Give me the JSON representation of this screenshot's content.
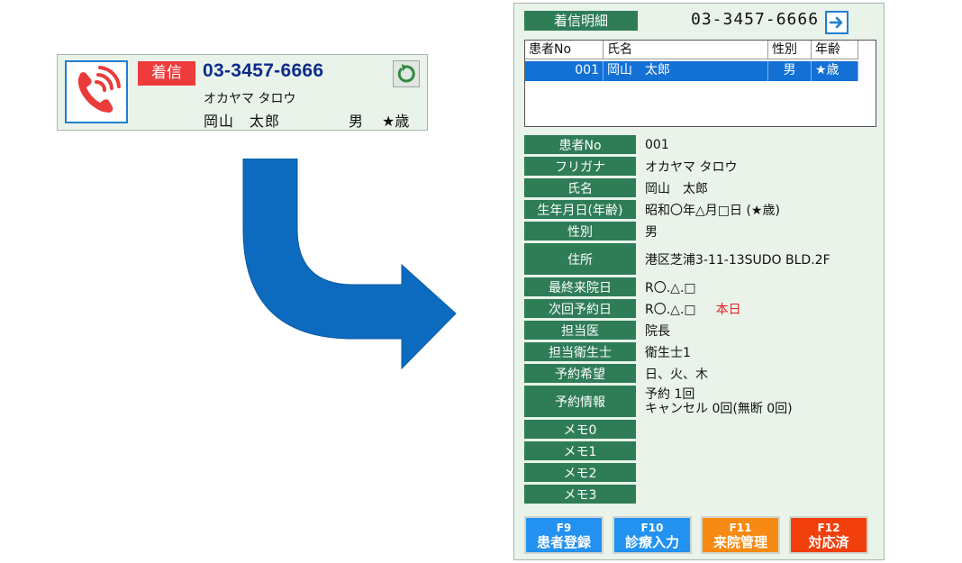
{
  "notification": {
    "badge": "着信",
    "phone": "03-3457-6666",
    "kana": "オカヤマ タロウ",
    "name": "岡山　太郎",
    "sex": "男",
    "age": "★歳",
    "icons": {
      "phone": "phone-ringing-icon",
      "refresh": "refresh-icon"
    }
  },
  "panel": {
    "title": "着信明細",
    "phone": "03-3457-6666",
    "table": {
      "headers": [
        "患者No",
        "氏名",
        "性別",
        "年齢"
      ],
      "rows": [
        {
          "no": "001",
          "name": "岡山　太郎",
          "sex": "男",
          "age": "★歳"
        }
      ]
    },
    "details": [
      {
        "label": "患者No",
        "value": "001"
      },
      {
        "label": "フリガナ",
        "value": "オカヤマ タロウ"
      },
      {
        "label": "氏名",
        "value": "岡山　太郎"
      },
      {
        "label": "生年月日(年齢)",
        "value": "昭和〇年△月□日 (★歳)"
      },
      {
        "label": "性別",
        "value": "男"
      },
      {
        "label": "住所",
        "value": "港区芝浦3-11-13SUDO BLD.2F"
      },
      {
        "label": "最終来院日",
        "value": "R〇.△.□"
      },
      {
        "label": "次回予約日",
        "value": "R〇.△.□",
        "note": "本日"
      },
      {
        "label": "担当医",
        "value": "院長"
      },
      {
        "label": "担当衛生士",
        "value": "衛生士1"
      },
      {
        "label": "予約希望",
        "value": "日、火、木"
      },
      {
        "label": "予約情報",
        "value": "予約 1回",
        "value2": "キャンセル 0回(無断 0回)"
      },
      {
        "label": "メモ0",
        "value": ""
      },
      {
        "label": "メモ1",
        "value": ""
      },
      {
        "label": "メモ2",
        "value": ""
      },
      {
        "label": "メモ3",
        "value": ""
      }
    ],
    "buttons": [
      {
        "key": "F9",
        "label": "患者登録"
      },
      {
        "key": "F10",
        "label": "診療入力"
      },
      {
        "key": "F11",
        "label": "来院管理"
      },
      {
        "key": "F12",
        "label": "対応済"
      }
    ]
  },
  "colors": {
    "panel_bg": "#e9f3ea",
    "label_green": "#2f7d57",
    "selected_row": "#1371d6",
    "badge_red": "#ef3b3b",
    "today_red": "#e02020",
    "arrow_blue": "#0c6bbf",
    "btn_f9": "#2392f0",
    "btn_f10": "#2392f0",
    "btn_f11": "#f78a12",
    "btn_f12": "#f2400c"
  }
}
